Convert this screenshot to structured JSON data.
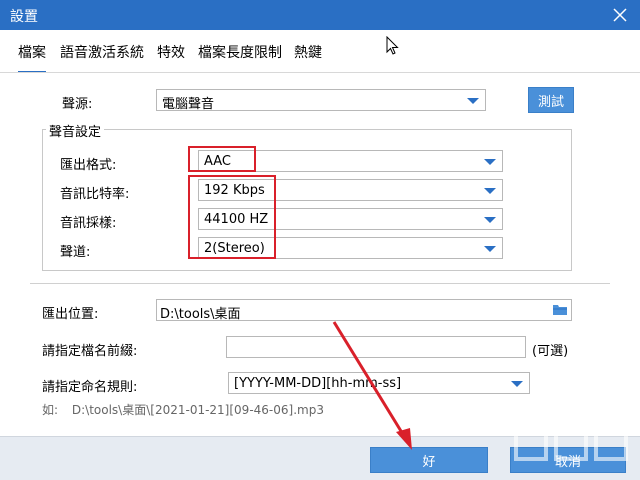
{
  "window": {
    "title": "設置"
  },
  "tabs": [
    {
      "label": "檔案",
      "active": true
    },
    {
      "label": "語音激活系統",
      "active": false
    },
    {
      "label": "特效",
      "active": false
    },
    {
      "label": "檔案長度限制",
      "active": false
    },
    {
      "label": "熱鍵",
      "active": false
    }
  ],
  "source": {
    "label": "聲源:",
    "value": "電腦聲音",
    "test_button": "測試"
  },
  "sound_settings": {
    "legend": "聲音設定",
    "format": {
      "label": "匯出格式:",
      "value": "AAC"
    },
    "bitrate": {
      "label": "音訊比特率:",
      "value": "192 Kbps"
    },
    "sample_rate": {
      "label": "音訊採樣:",
      "value": "44100 HZ"
    },
    "channel": {
      "label": "聲道:",
      "value": "2(Stereo)"
    }
  },
  "output": {
    "location_label": "匯出位置:",
    "location_value": "D:\\tools\\桌面",
    "prefix_label": "請指定檔名前綴:",
    "prefix_value": "",
    "optional": "(可選)",
    "naming_label": "請指定命名規則:",
    "naming_value": "[YYYY-MM-DD][hh-mm-ss]",
    "example_prefix": "如:",
    "example_value": "D:\\tools\\桌面\\[2021-01-21][09-46-06].mp3"
  },
  "footer": {
    "ok_button": "好",
    "cancel_button": "取消"
  },
  "colors": {
    "titlebar": "#2a6fc4",
    "accent": "#4a90d9",
    "highlight_box": "#d9202a",
    "arrow": "#d9202a"
  }
}
